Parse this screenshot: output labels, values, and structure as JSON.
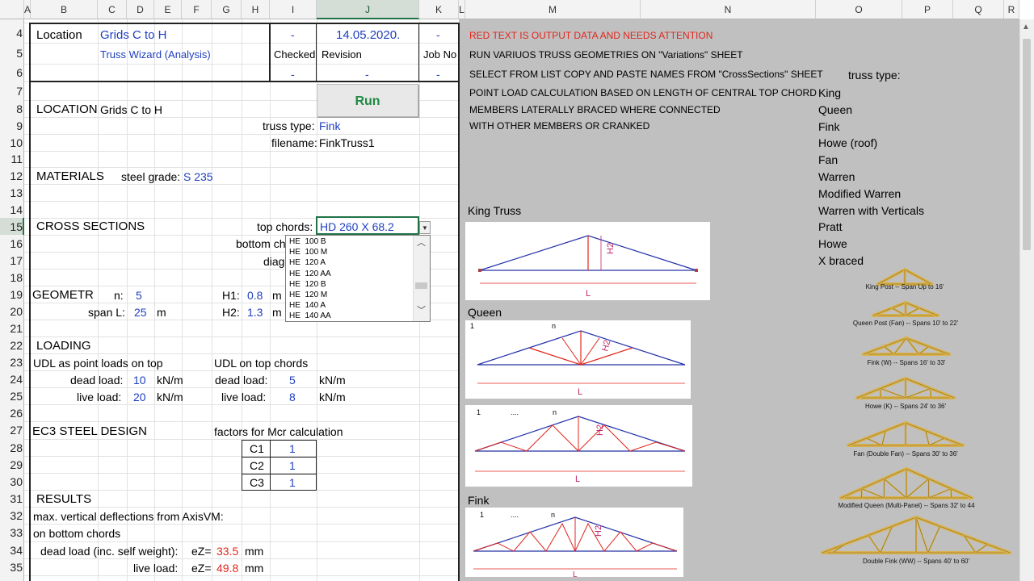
{
  "columns": [
    "A",
    "B",
    "C",
    "D",
    "E",
    "F",
    "G",
    "H",
    "I",
    "J",
    "K",
    "L",
    "M",
    "N",
    "O",
    "P",
    "Q",
    "R"
  ],
  "rows": [
    "4",
    "5",
    "6",
    "7",
    "8",
    "9",
    "10",
    "11",
    "12",
    "13",
    "14",
    "15",
    "16",
    "17",
    "18",
    "19",
    "20",
    "21",
    "22",
    "23",
    "24",
    "25",
    "26",
    "27",
    "28",
    "29",
    "30",
    "31",
    "32",
    "33",
    "34",
    "35"
  ],
  "header": {
    "location_label": "Location",
    "grids": "Grids C to H",
    "dash_i4": "-",
    "date": "14.05.2020.",
    "dash_k4": "-",
    "wizard": "Truss Wizard (Analysis)",
    "checked": "Checked",
    "revision": "Revision",
    "job_no": "Job No",
    "dash_i6": "-",
    "dash_j6": "-",
    "dash_k6": "-"
  },
  "run_label": "Run",
  "location": {
    "label": "LOCATION",
    "value": "Grids C to H"
  },
  "truss_type": {
    "label": "truss type:",
    "value": "Fink"
  },
  "filename": {
    "label": "filename:",
    "value": "FinkTruss1"
  },
  "materials": {
    "label": "MATERIALS",
    "grade_label": "steel grade:",
    "grade": "S 235"
  },
  "cross_sections": {
    "label": "CROSS SECTIONS",
    "top_label": "top chords:",
    "top_value": "HD 260 X  68.2",
    "bottom_label": "bottom ch",
    "diag_label": "diago"
  },
  "dropdown": {
    "options": [
      "HE  100 B",
      "HE  100 M",
      "HE  120 A",
      "HE  120 AA",
      "HE  120 B",
      "HE  120 M",
      "HE  140 A",
      "HE  140 AA"
    ]
  },
  "geometry": {
    "label": "GEOMETR",
    "n_label": "n:",
    "n": "5",
    "span_label": "span L:",
    "span": "25",
    "span_unit": "m",
    "h1_label": "H1:",
    "h1": "0.8",
    "h1_unit": "m",
    "h2_label": "H2:",
    "h2": "1.3",
    "h2_unit": "m"
  },
  "loading": {
    "label": "LOADING",
    "udl_point": "UDL as point loads on top",
    "udl_chords": "UDL on top chords",
    "dead_label": "dead load:",
    "dead1": "10",
    "dead2": "5",
    "live_label": "live load:",
    "live1": "20",
    "live2": "8",
    "unit": "kN/m"
  },
  "ec3": {
    "label": "EC3 STEEL DESIGN",
    "factors": "factors for Mcr calculation",
    "c1_label": "C1",
    "c1": "1",
    "c2_label": "C2",
    "c2": "1",
    "c3_label": "C3",
    "c3": "1"
  },
  "results": {
    "label": "RESULTS",
    "line1": "max. vertical deflections from AxisVM:",
    "line2": "on  bottom chords",
    "dead_label": "dead load (inc. self weight):",
    "dead_ez": "eZ=",
    "dead_val": "33.5",
    "live_label": "live load:",
    "live_ez": "eZ=",
    "live_val": "49.8",
    "unit": "mm"
  },
  "notes": {
    "red": "RED TEXT IS OUTPUT DATA AND NEEDS ATTENTION",
    "n1": "RUN VARIUOS TRUSS GEOMETRIES ON \"Variations\" SHEET",
    "n2": "SELECT FROM LIST COPY AND PASTE NAMES FROM \"CrossSections\" SHEET",
    "n3": "POINT LOAD CALCULATION BASED ON LENGTH OF CENTRAL TOP CHORD",
    "n4": "MEMBERS LATERALLY BRACED WHERE CONNECTED",
    "n5": "WITH OTHER MEMBERS OR CRANKED"
  },
  "truss_list": {
    "title": "truss type:",
    "items": [
      "King",
      "Queen",
      "Fink",
      "Howe (roof)",
      "Fan",
      "Warren",
      "Modified Warren",
      "Warren with Verticals",
      "Pratt",
      "Howe",
      "X braced"
    ]
  },
  "figures": {
    "king_title": "King Truss",
    "queen_title": "Queen",
    "fink_title": "Fink",
    "h2": "H2",
    "L": "L",
    "one": "1",
    "n": "n",
    "dots": "...."
  },
  "gallery": [
    "King Post -- Span Up to 16'",
    "Queen Post (Fan) -- Spans 10' to 22'",
    "Fink (W) -- Spans 16' to 33'",
    "Howe (K) -- Spans 24' to 36'",
    "Fan (Double Fan) -- Spans 30' to 36'",
    "Modified Queen (Multi-Panel) -- Spans 32' to 44",
    "Double Fink (WW) -- Spans 40' to 60'"
  ],
  "colors": {
    "grey_bg": "#c0c0c0",
    "input_blue": "#1f3fbf",
    "output_red": "#e2261d",
    "run_green": "#1e8a43",
    "grid": "#e2e2e2"
  }
}
